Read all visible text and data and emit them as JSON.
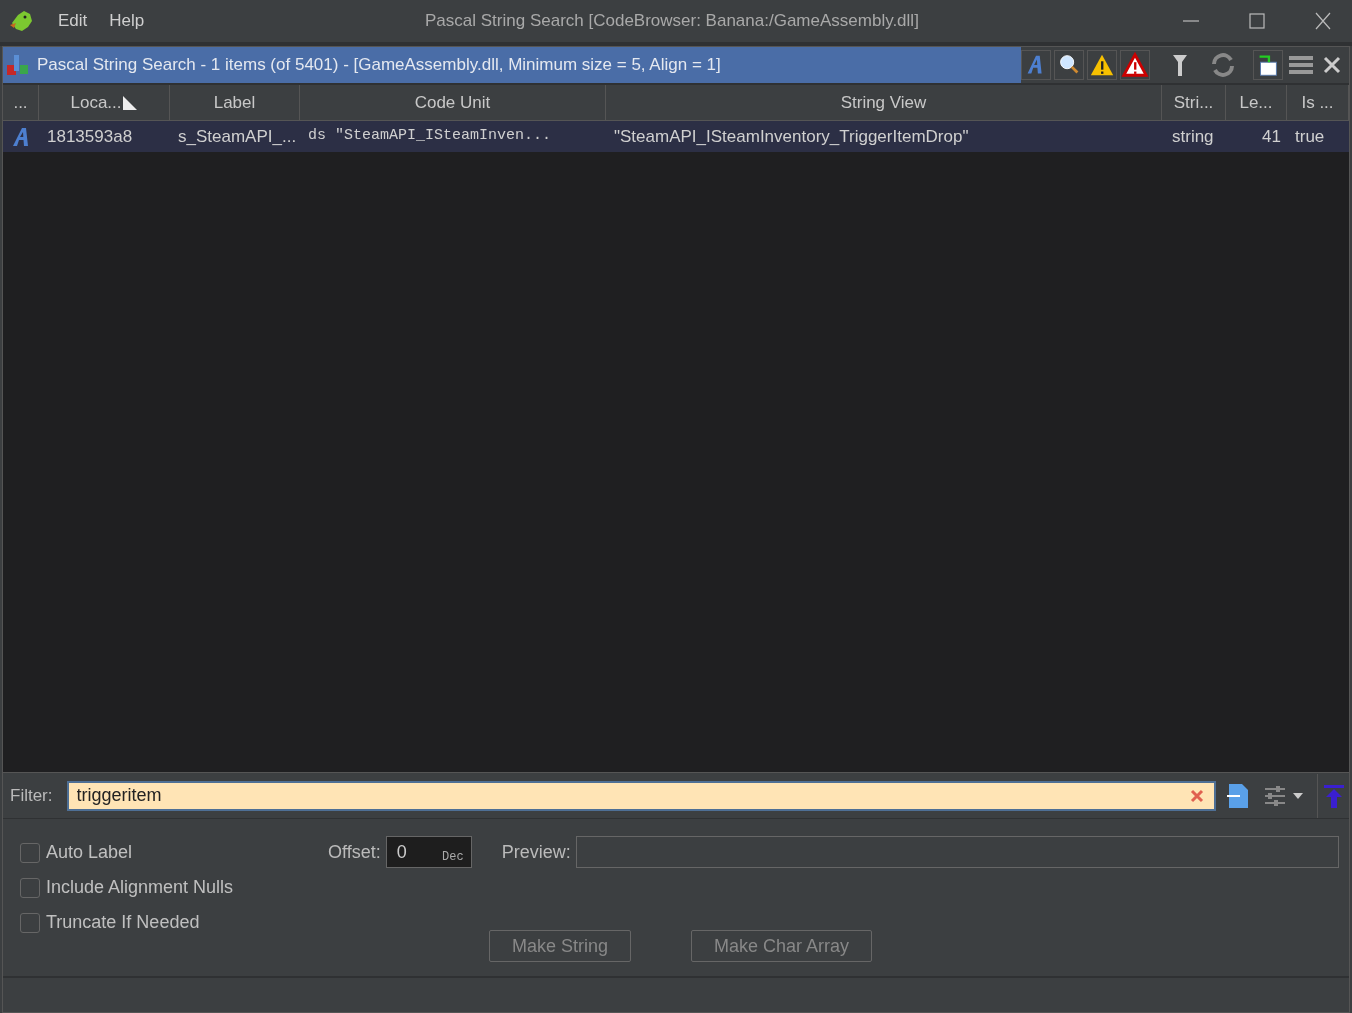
{
  "window": {
    "title": "Pascal String Search [CodeBrowser: Banana:/GameAssembly.dll]"
  },
  "menu": [
    "Edit",
    "Help"
  ],
  "panel": {
    "title": "Pascal String Search - 1 items (of 5401) - [GameAssembly.dll, Minimum size = 5, Align = 1]"
  },
  "table": {
    "columns": [
      {
        "label": "...",
        "sorted": false
      },
      {
        "label": "Loca...",
        "sorted": true
      },
      {
        "label": "Label",
        "sorted": false
      },
      {
        "label": "Code Unit",
        "sorted": false
      },
      {
        "label": "String View",
        "sorted": false
      },
      {
        "label": "Stri...",
        "sorted": false
      },
      {
        "label": "Le...",
        "sorted": false
      },
      {
        "label": "Is ...",
        "sorted": false
      }
    ],
    "rows": [
      {
        "selected": true,
        "location": "1813593a8",
        "label": "s_SteamAPI_...",
        "code_unit": "ds \"SteamAPI_ISteamInven...",
        "string_view": "\"SteamAPI_ISteamInventory_TriggerItemDrop\"",
        "string_type": "string",
        "length": "41",
        "is_column": "true"
      }
    ]
  },
  "filter": {
    "label": "Filter:",
    "value": "triggeritem"
  },
  "options": [
    {
      "label": "Auto Label",
      "checked": false
    },
    {
      "label": "Include Alignment Nulls",
      "checked": false
    },
    {
      "label": "Truncate If Needed",
      "checked": false
    }
  ],
  "offset": {
    "label": "Offset:",
    "value": "0",
    "unit": "Dec"
  },
  "preview": {
    "label": "Preview:"
  },
  "buttons": [
    {
      "label": "Make String",
      "disabled": true
    },
    {
      "label": "Make Char Array",
      "disabled": true
    }
  ]
}
